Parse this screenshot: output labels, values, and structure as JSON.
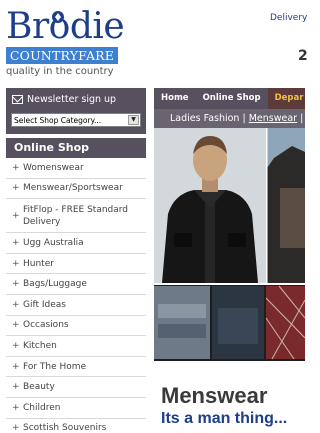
{
  "logo": {
    "word": "Brodie",
    "band": "COUNTRYFARE",
    "tagline": "quality in the country"
  },
  "header": {
    "top_link": "Delivery",
    "partial_number": "2"
  },
  "sidebar": {
    "newsletter_label": "Newsletter sign up",
    "shop_select": "Select Shop Category...",
    "online_shop_heading": "Online Shop",
    "categories": [
      "Womenswear",
      "Menswear/Sportswear",
      "FitFlop - FREE Standard Delivery",
      "Ugg Australia",
      "Hunter",
      "Bags/Luggage",
      "Gift Ideas",
      "Occasions",
      "Kitchen",
      "For The Home",
      "Beauty",
      "Children",
      "Scottish Souvenirs"
    ]
  },
  "nav": {
    "items": [
      "Home",
      "Online Shop",
      "Depar"
    ]
  },
  "breadcrumb": {
    "first": "Ladies Fashion",
    "current": "Menswear",
    "partial": "La"
  },
  "hero": {
    "colors": {
      "jacket": "#1b1b1b",
      "skin": "#c9a27e",
      "sky": "#8fa6b8"
    }
  },
  "main": {
    "headline": "Menswear",
    "subline": "Its a man thing..."
  },
  "colors": {
    "brand_blue": "#1d3f8a",
    "band_blue": "#3d7fd0",
    "nav_bg": "#57505f",
    "active_tab": "#5e3b3b"
  }
}
